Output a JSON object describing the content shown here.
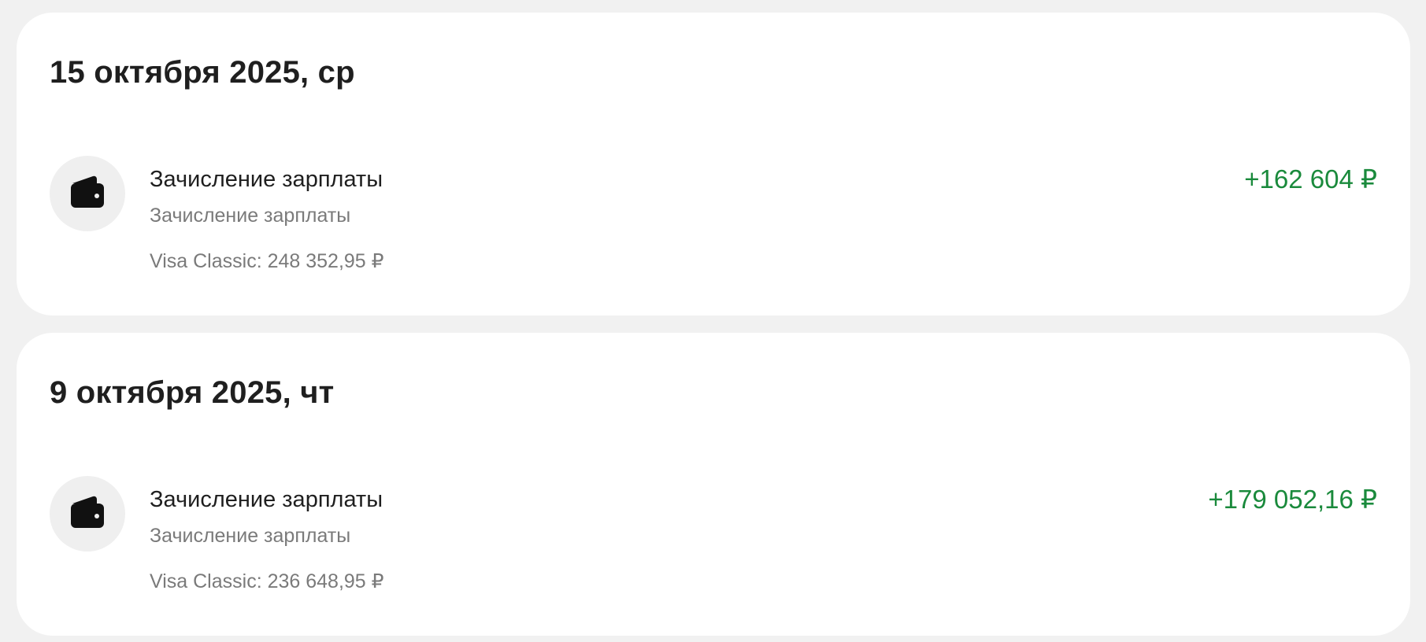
{
  "colors": {
    "page_background": "#f1f1f1",
    "card_background": "#ffffff",
    "income_amount": "#1a8a3c",
    "secondary_text": "#7a7a7a",
    "primary_text": "#1f1f1f",
    "icon_circle": "#efefef"
  },
  "groups": [
    {
      "date": "15 октября 2025, ср",
      "transaction": {
        "icon": "wallet-icon",
        "title": "Зачисление зарплаты",
        "subtitle": "Зачисление зарплаты",
        "account": "Visa Classic:  248 352,95 ₽",
        "amount": "+162 604 ₽"
      }
    },
    {
      "date": "9 октября 2025, чт",
      "transaction": {
        "icon": "wallet-icon",
        "title": "Зачисление зарплаты",
        "subtitle": "Зачисление зарплаты",
        "account": "Visa Classic:  236 648,95 ₽",
        "amount": "+179 052,16 ₽"
      }
    }
  ]
}
